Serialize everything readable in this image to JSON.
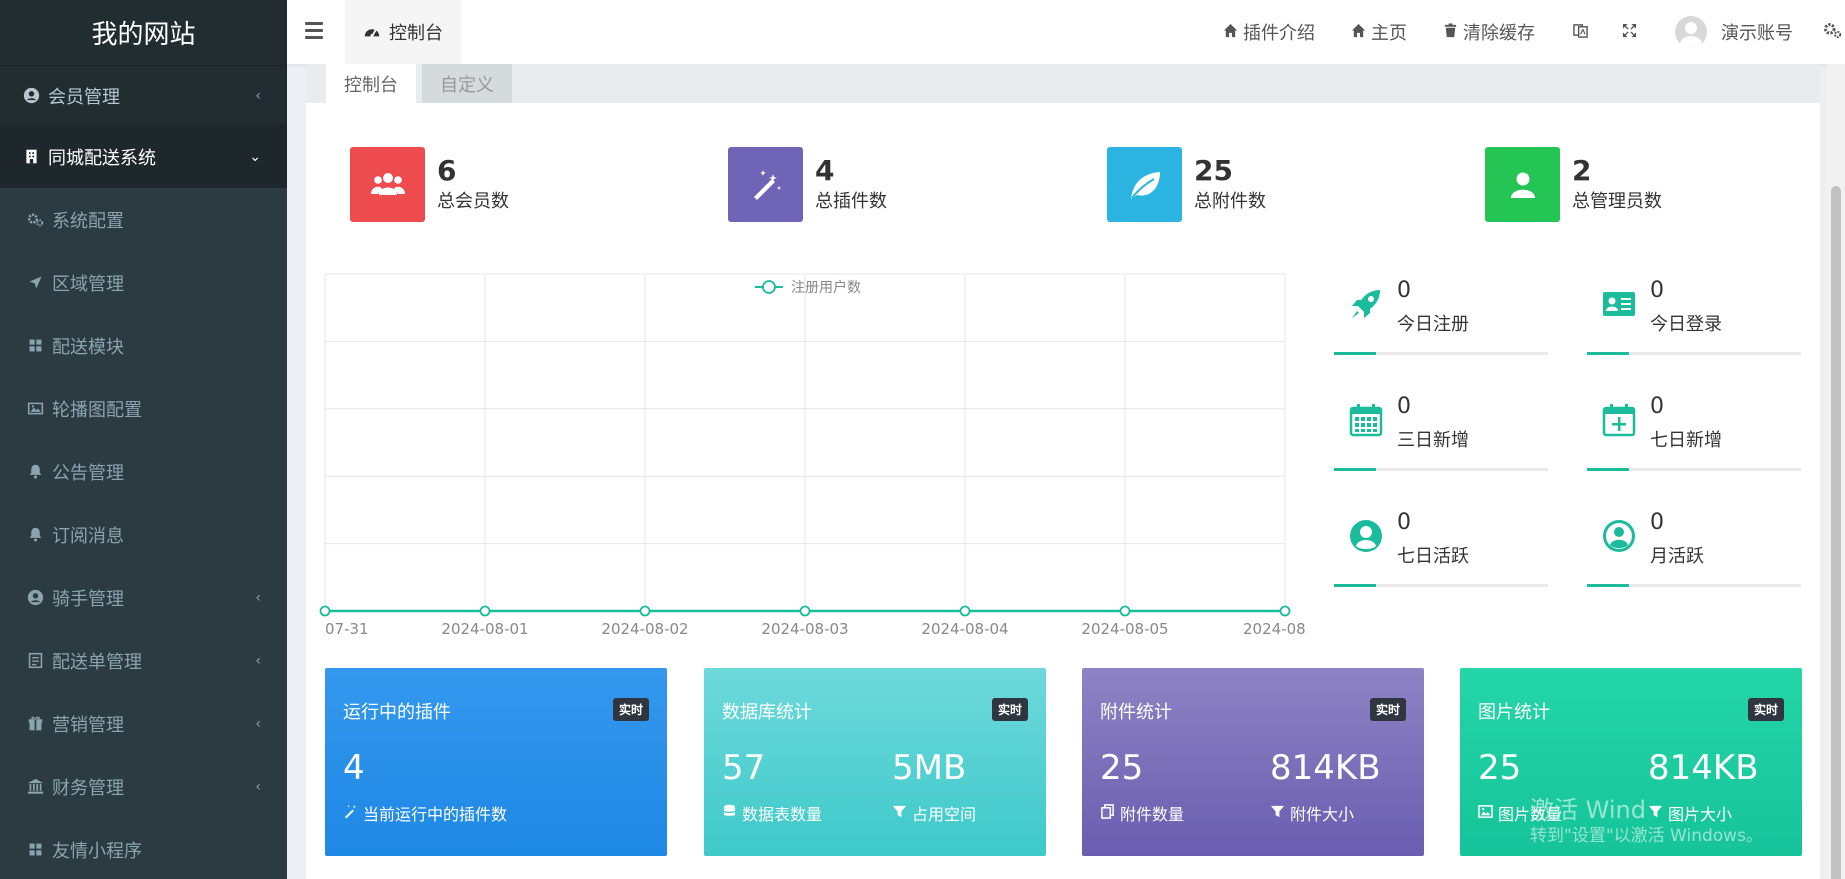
{
  "brand": "我的网站",
  "sidebar": {
    "items": [
      {
        "label": "会员管理",
        "icon": "user-circle-icon",
        "arrow": "‹"
      },
      {
        "label": "同城配送系统",
        "icon": "building-icon",
        "arrow": "⌄"
      },
      {
        "label": "系统配置",
        "icon": "gears-icon"
      },
      {
        "label": "区域管理",
        "icon": "location-arrow-icon"
      },
      {
        "label": "配送模块",
        "icon": "grid-icon"
      },
      {
        "label": "轮播图配置",
        "icon": "image-icon"
      },
      {
        "label": "公告管理",
        "icon": "bell-icon"
      },
      {
        "label": "订阅消息",
        "icon": "bell-icon"
      },
      {
        "label": "骑手管理",
        "icon": "user-circle-icon",
        "arrow": "‹"
      },
      {
        "label": "配送单管理",
        "icon": "list-icon",
        "arrow": "‹"
      },
      {
        "label": "营销管理",
        "icon": "gift-icon",
        "arrow": "‹"
      },
      {
        "label": "财务管理",
        "icon": "bank-icon",
        "arrow": "‹"
      },
      {
        "label": "友情小程序",
        "icon": "grid-icon"
      }
    ]
  },
  "header": {
    "tab": "控制台",
    "links": [
      {
        "label": "插件介绍",
        "icon": "home-icon"
      },
      {
        "label": "主页",
        "icon": "home-icon"
      },
      {
        "label": "清除缓存",
        "icon": "trash-icon"
      }
    ],
    "user": "演示账号"
  },
  "content_tabs": [
    "控制台",
    "自定义"
  ],
  "stats": [
    {
      "value": "6",
      "label": "总会员数",
      "color": "#ee4b4f",
      "icon": "users-icon"
    },
    {
      "value": "4",
      "label": "总插件数",
      "color": "#6f64b5",
      "icon": "magic-icon"
    },
    {
      "value": "25",
      "label": "总附件数",
      "color": "#2bb4e0",
      "icon": "leaf-icon"
    },
    {
      "value": "2",
      "label": "总管理员数",
      "color": "#24c455",
      "icon": "user-icon"
    }
  ],
  "chart_data": {
    "type": "line",
    "x": [
      "2024-07-31",
      "2024-08-01",
      "2024-08-02",
      "2024-08-03",
      "2024-08-04",
      "2024-08-05",
      "2024-08-06"
    ],
    "x_tick_labels": [
      "07-31",
      "2024-08-01",
      "2024-08-02",
      "2024-08-03",
      "2024-08-04",
      "2024-08-05",
      "2024-08"
    ],
    "series": [
      {
        "name": "注册用户数",
        "values": [
          0,
          0,
          0,
          0,
          0,
          0,
          0
        ],
        "color": "#1abc9c"
      }
    ],
    "legend": "top-center",
    "grid": true
  },
  "mini_stats": [
    {
      "value": "0",
      "label": "今日注册",
      "icon": "rocket-icon"
    },
    {
      "value": "0",
      "label": "今日登录",
      "icon": "id-card-icon"
    },
    {
      "value": "0",
      "label": "三日新增",
      "icon": "calendar-icon"
    },
    {
      "value": "0",
      "label": "七日新增",
      "icon": "calendar-plus-icon"
    },
    {
      "value": "0",
      "label": "七日活跃",
      "icon": "user-circle-icon"
    },
    {
      "value": "0",
      "label": "月活跃",
      "icon": "user-circle-icon"
    }
  ],
  "cards": [
    {
      "title": "运行中的插件",
      "badge": "实时",
      "values": [
        {
          "value": "4",
          "label": "当前运行中的插件数",
          "icon": "magic-icon"
        }
      ]
    },
    {
      "title": "数据库统计",
      "badge": "实时",
      "values": [
        {
          "value": "57",
          "label": "数据表数量",
          "icon": "database-icon"
        },
        {
          "value": "5MB",
          "label": "占用空间",
          "icon": "filter-icon"
        }
      ]
    },
    {
      "title": "附件统计",
      "badge": "实时",
      "values": [
        {
          "value": "25",
          "label": "附件数量",
          "icon": "files-icon"
        },
        {
          "value": "814KB",
          "label": "附件大小",
          "icon": "filter-icon"
        }
      ]
    },
    {
      "title": "图片统计",
      "badge": "实时",
      "values": [
        {
          "value": "25",
          "label": "图片数量",
          "icon": "image-icon"
        },
        {
          "value": "814KB",
          "label": "图片大小",
          "icon": "filter-icon"
        }
      ]
    }
  ],
  "watermark": {
    "line1": "激活 Wind",
    "line2": "转到\"设置\"以激活 Windows。"
  }
}
